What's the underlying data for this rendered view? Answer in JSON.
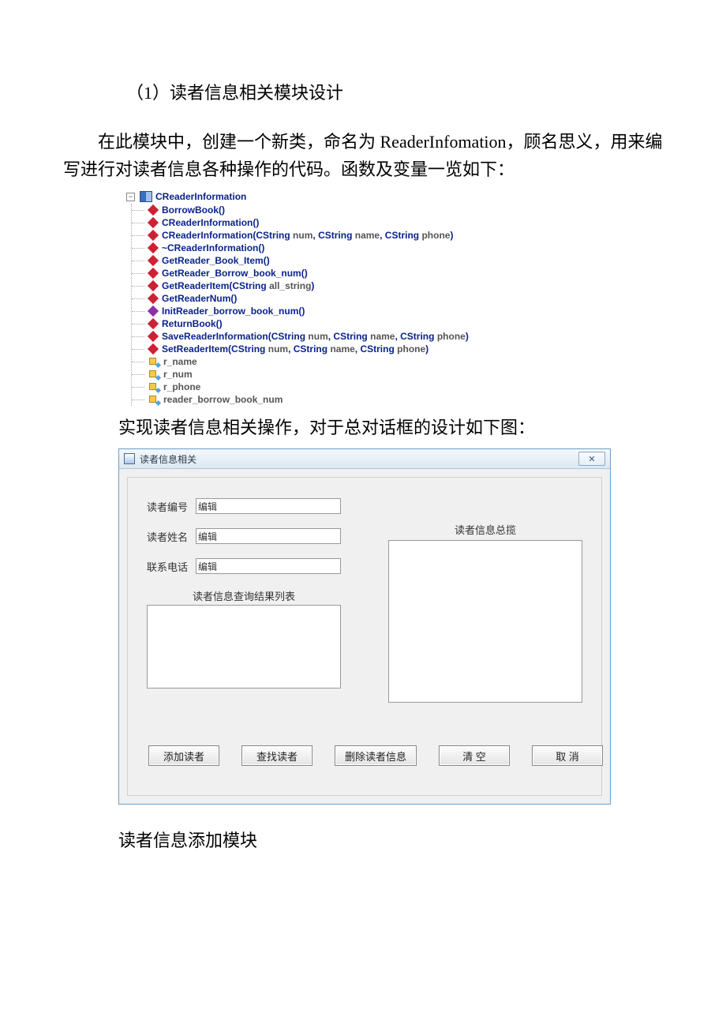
{
  "doc": {
    "heading": "（1）读者信息相关模块设计",
    "para1": "在此模块中，创建一个新类，命名为 ReaderInfomation，顾名思义，用来编写进行对读者信息各种操作的代码。函数及变量一览如下：",
    "caption": "实现读者信息相关操作，对于总对话框的设计如下图：",
    "after": "读者信息添加模块"
  },
  "tree": {
    "class_name": "CReaderInformation",
    "items": [
      {
        "kind": "method",
        "name": "BorrowBook",
        "params": []
      },
      {
        "kind": "method",
        "name": "CReaderInformation",
        "params": []
      },
      {
        "kind": "method",
        "name": "CReaderInformation",
        "params": [
          [
            "CString",
            "num"
          ],
          [
            "CString",
            "name"
          ],
          [
            "CString",
            "phone"
          ]
        ]
      },
      {
        "kind": "method",
        "name": "~CReaderInformation",
        "params": []
      },
      {
        "kind": "method",
        "name": "GetReader_Book_Item",
        "params": []
      },
      {
        "kind": "method",
        "name": "GetReader_Borrow_book_num",
        "params": []
      },
      {
        "kind": "method",
        "name": "GetReaderItem",
        "params": [
          [
            "CString",
            "all_string"
          ]
        ]
      },
      {
        "kind": "method",
        "name": "GetReaderNum",
        "params": []
      },
      {
        "kind": "vmethod",
        "name": "InitReader_borrow_book_num",
        "params": []
      },
      {
        "kind": "method",
        "name": "ReturnBook",
        "params": []
      },
      {
        "kind": "method",
        "name": "SaveReaderInformation",
        "params": [
          [
            "CString",
            "num"
          ],
          [
            "CString",
            "name"
          ],
          [
            "CString",
            "phone"
          ]
        ]
      },
      {
        "kind": "method",
        "name": "SetReaderItem",
        "params": [
          [
            "CString",
            "num"
          ],
          [
            "CString",
            "name"
          ],
          [
            "CString",
            "phone"
          ]
        ]
      },
      {
        "kind": "var",
        "name": "r_name"
      },
      {
        "kind": "var",
        "name": "r_num"
      },
      {
        "kind": "var",
        "name": "r_phone"
      },
      {
        "kind": "var",
        "name": "reader_borrow_book_num"
      }
    ]
  },
  "dialog": {
    "title": "读者信息相关",
    "close_glyph": "✕",
    "labels": {
      "id": "读者编号",
      "name": "读者姓名",
      "phone": "联系电话",
      "result_list": "读者信息查询结果列表",
      "overview": "读者信息总揽"
    },
    "inputs": {
      "id_value": "编辑",
      "name_value": "编辑",
      "phone_value": "编辑"
    },
    "buttons": {
      "add": "添加读者",
      "find": "查找读者",
      "delete": "删除读者信息",
      "clear": "清 空",
      "cancel": "取 消"
    }
  }
}
